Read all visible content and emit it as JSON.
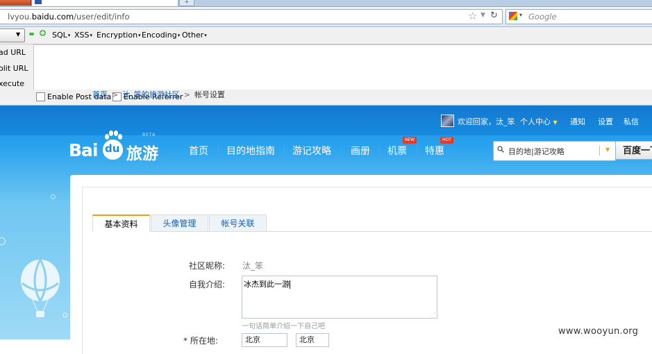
{
  "browser": {
    "url_prefix": "lvyou.",
    "url_domain": "baidu.com",
    "url_path": "/user/edit/info",
    "search_placeholder": "Google"
  },
  "hackbar": {
    "menus": [
      "SQL",
      "XSS",
      "Encryption",
      "Encoding",
      "Other"
    ],
    "side_items": [
      "ad URL",
      "olit URL",
      "xecute"
    ],
    "options": [
      "Enable Post data",
      "Enable Referrer"
    ]
  },
  "site": {
    "logo_bai": "Bai",
    "logo_du": "du",
    "logo_product": "旅游",
    "logo_beta": "BETA",
    "topbar": {
      "welcome": "欢迎回家，",
      "username": "汰_笨",
      "personal_center": "个人中心",
      "notify": "通知",
      "settings": "设置",
      "messages": "私信"
    },
    "nav": [
      {
        "label": "首页"
      },
      {
        "label": "目的地指南"
      },
      {
        "label": "游记攻略"
      },
      {
        "label": "画册"
      },
      {
        "label": "机票",
        "badge": "NEW"
      },
      {
        "label": "特惠",
        "badge": "HOT"
      }
    ],
    "search_placeholder": "目的地|游记攻略",
    "search_button": "百度一下"
  },
  "breadcrumb": {
    "home": "首页",
    "community": "汰_笨的旅游社区",
    "current": "帐号设置",
    "sep": ">"
  },
  "tabs": [
    "基本资料",
    "头像管理",
    "帐号关联"
  ],
  "form": {
    "nickname_label": "社区昵称:",
    "nickname_value": "汰_笨",
    "intro_label": "自我介绍:",
    "intro_value": "冰杰到此一游",
    "intro_hint": "一句话简单介绍一下自己吧",
    "region_label": "* 所在地:",
    "region_value_1": "北京",
    "region_value_2": "北京"
  },
  "watermark": "www.wooyun.org",
  "colors": {
    "baidu_blue": "#1a8be0",
    "link_blue": "#1561b7",
    "tab_accent": "#f2a000",
    "badge_red": "#e03b2b"
  }
}
